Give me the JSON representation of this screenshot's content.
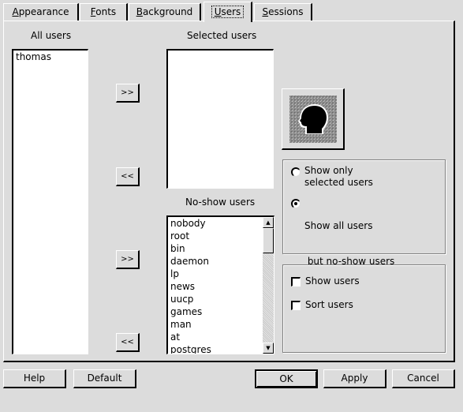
{
  "tabs": [
    {
      "label": "Appearance",
      "accel": "A",
      "rest": "ppearance",
      "active": false
    },
    {
      "label": "Fonts",
      "accel": "F",
      "rest": "onts",
      "active": false
    },
    {
      "label": "Background",
      "accel": "B",
      "rest": "ackground",
      "active": false
    },
    {
      "label": "Users",
      "accel": "U",
      "rest": "sers",
      "active": true
    },
    {
      "label": "Sessions",
      "accel": "S",
      "rest": "essions",
      "active": false
    }
  ],
  "all_users": {
    "label": "All users",
    "items": [
      "thomas"
    ]
  },
  "selected_users": {
    "label": "Selected users",
    "items": []
  },
  "no_show_users": {
    "label": "No-show users",
    "items": [
      "nobody",
      "root",
      "bin",
      "daemon",
      "lp",
      "news",
      "uucp",
      "games",
      "man",
      "at",
      "postgres"
    ]
  },
  "move_buttons": {
    "add_selected": ">>",
    "remove_selected": "<<",
    "add_noshow": ">>",
    "remove_noshow": "<<"
  },
  "user_image": {
    "icon": "user-head-silhouette-icon"
  },
  "show_mode": {
    "options": [
      {
        "line1": "Show only",
        "line2": "selected users",
        "checked": false
      },
      {
        "line1": "Show all users",
        "line2": " but no-show users",
        "checked": true
      }
    ]
  },
  "options": {
    "show_users": {
      "label": "Show users",
      "checked": false
    },
    "sort_users": {
      "label": "Sort users",
      "checked": false
    }
  },
  "buttons": {
    "help": "Help",
    "default": "Default",
    "ok": "OK",
    "apply": "Apply",
    "cancel": "Cancel"
  }
}
